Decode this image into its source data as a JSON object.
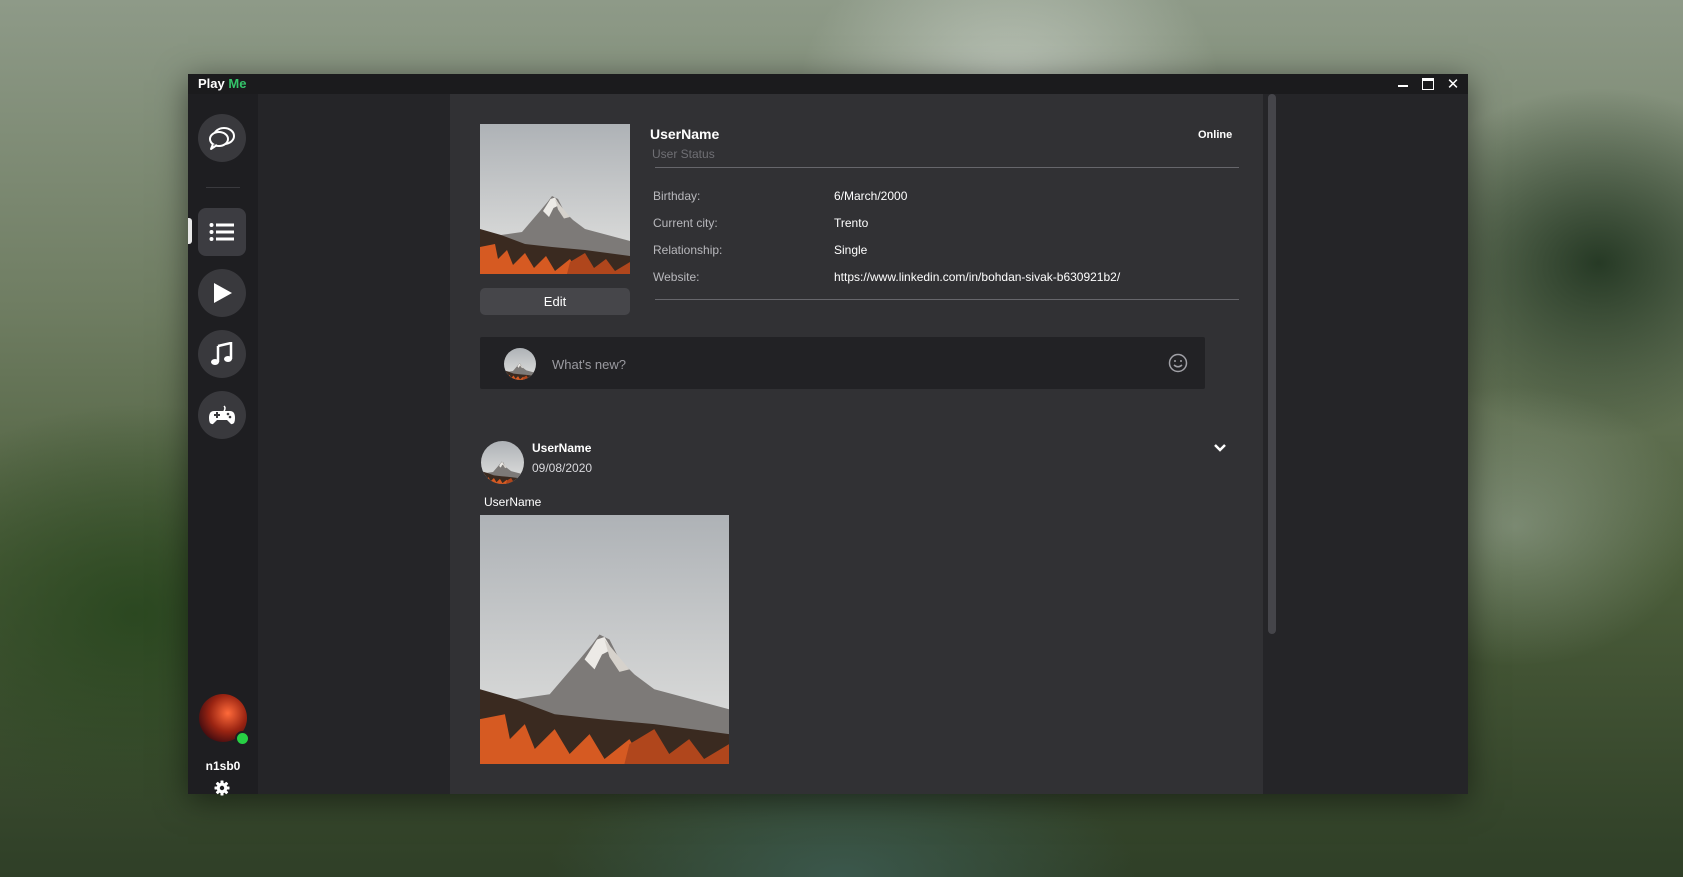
{
  "app": {
    "title_part1": "Play",
    "title_part2": "Me",
    "accent_color": "#34c46a",
    "window_controls": [
      "minimize-icon",
      "maximize-icon",
      "close-icon"
    ]
  },
  "sidebar": {
    "items": [
      {
        "icon": "chat-bubbles-icon"
      },
      {
        "icon": "list-icon",
        "active": true
      },
      {
        "icon": "play-icon"
      },
      {
        "icon": "music-note-icon"
      },
      {
        "icon": "gamepad-icon"
      }
    ],
    "user": {
      "name": "n1sb0",
      "status_color": "#27d044",
      "settings_icon": "gear-icon"
    }
  },
  "profile": {
    "username": "UserName",
    "user_status": "User Status",
    "presence": "Online",
    "edit_label": "Edit",
    "info": [
      {
        "label": "Birthday:",
        "value": "6/March/2000"
      },
      {
        "label": "Current city:",
        "value": "Trento"
      },
      {
        "label": "Relationship:",
        "value": "Single"
      },
      {
        "label": "Website:",
        "value": "https://www.linkedin.com/in/bohdan-sivak-b630921b2/"
      }
    ]
  },
  "composer": {
    "placeholder": "What's new?",
    "emoji_icon": "smiley-icon"
  },
  "post": {
    "author": "UserName",
    "date": "09/08/2020",
    "text": "UserName",
    "menu_icon": "chevron-down-icon"
  }
}
